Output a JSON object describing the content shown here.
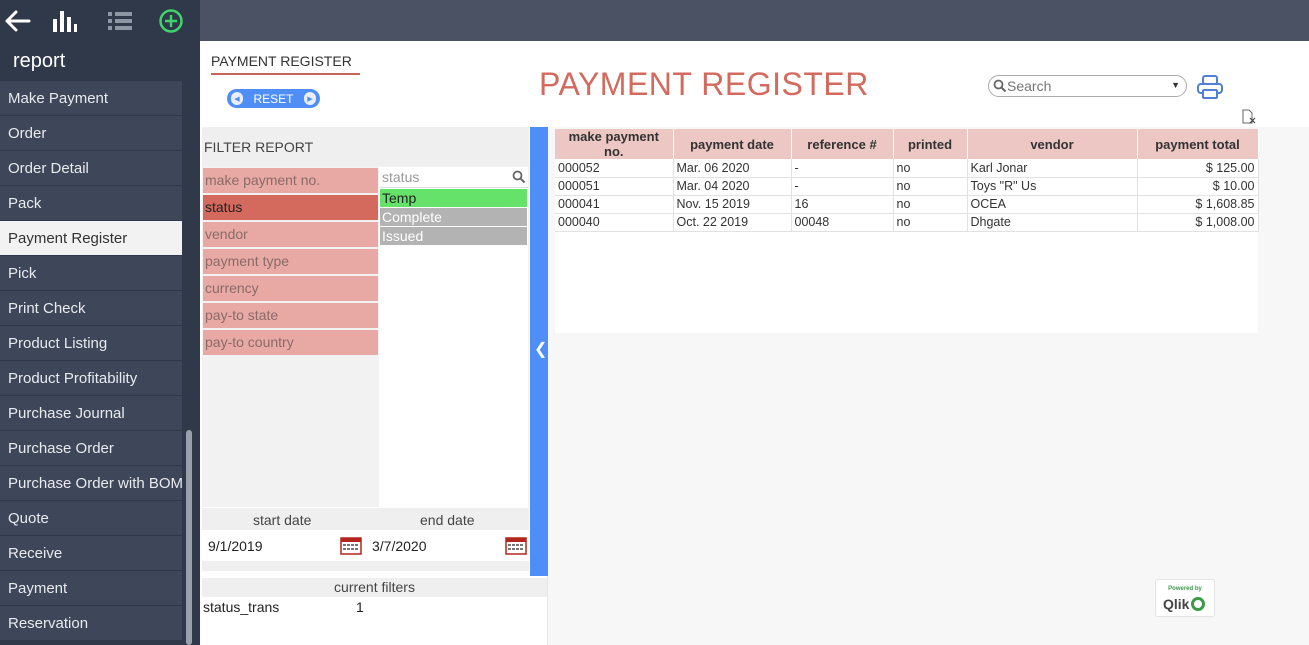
{
  "sidebar": {
    "section_title": "report",
    "items": [
      {
        "label": "Make Payment"
      },
      {
        "label": "Order"
      },
      {
        "label": "Order Detail"
      },
      {
        "label": "Pack"
      },
      {
        "label": "Payment Register",
        "active": true
      },
      {
        "label": "Pick"
      },
      {
        "label": "Print Check"
      },
      {
        "label": "Product Listing"
      },
      {
        "label": "Product Profitability"
      },
      {
        "label": "Purchase Journal"
      },
      {
        "label": "Purchase Order"
      },
      {
        "label": "Purchase Order with BOM"
      },
      {
        "label": "Quote"
      },
      {
        "label": "Receive"
      },
      {
        "label": "Payment"
      },
      {
        "label": "Reservation"
      }
    ],
    "icons": [
      "back-arrow-icon",
      "bar-chart-icon",
      "list-icon",
      "add-circle-icon"
    ]
  },
  "sheet": {
    "tab_title": "PAYMENT REGISTER",
    "reset_label": "RESET",
    "title": "PAYMENT REGISTER",
    "search_placeholder": "Search"
  },
  "filter": {
    "header": "FILTER REPORT",
    "fields": [
      "make payment no.",
      "status",
      "vendor",
      "payment type",
      "currency",
      "pay-to state",
      "pay-to country"
    ],
    "selected_field": "status",
    "listbox_title": "status",
    "listbox_values": [
      {
        "label": "Temp",
        "state": "selected"
      },
      {
        "label": "Complete",
        "state": "excluded"
      },
      {
        "label": "Issued",
        "state": "excluded"
      }
    ]
  },
  "dates": {
    "start_label": "start date",
    "end_label": "end date",
    "start_value": "9/1/2019",
    "end_value": "3/7/2020"
  },
  "current_filters": {
    "header": "current filters",
    "rows": [
      {
        "field": "status_trans",
        "count": "1"
      }
    ]
  },
  "table": {
    "columns": [
      "make payment no.",
      "payment date",
      "reference #",
      "printed",
      "vendor",
      "payment total"
    ],
    "rows": [
      [
        "000052",
        "Mar. 06 2020",
        "-",
        "no",
        "Karl Jonar",
        "$ 125.00"
      ],
      [
        "000051",
        "Mar. 04 2020",
        "-",
        "no",
        "Toys \"R\" Us",
        "$ 10.00"
      ],
      [
        "000041",
        "Nov. 15 2019",
        "16",
        "no",
        "OCEA",
        "$ 1,608.85"
      ],
      [
        "000040",
        "Oct. 22 2019",
        "00048",
        "no",
        "Dhgate",
        "$ 1,008.00"
      ]
    ]
  },
  "branding": {
    "powered_by": "Powered by",
    "qlik": "Qlik"
  },
  "colors": {
    "accent_red": "#d46a5e",
    "accent_blue": "#4f8ef7",
    "selected_green": "#64e26a",
    "sidebar_bg": "#2f3949"
  }
}
